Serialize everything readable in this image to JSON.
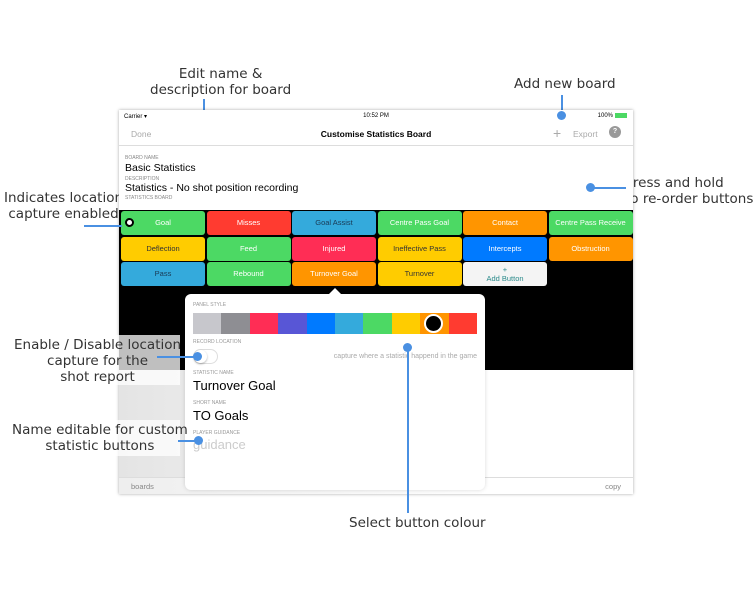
{
  "annotations": {
    "edit_name": "Edit name &\ndescription for board",
    "add_board": "Add new board",
    "location_capture": "Indicates location\ncapture enabled",
    "press_hold": "Press and hold\nto re-order buttons",
    "enable_disable": "Enable / Disable location\ncapture for the\nshot report",
    "name_editable": "Name editable for custom\nstatistic buttons",
    "select_colour": "Select button colour"
  },
  "status_bar": {
    "carrier": "Carrier",
    "time": "10:52 PM",
    "battery": "100%"
  },
  "nav": {
    "done": "Done",
    "title": "Customise Statistics Board",
    "add": "+",
    "export": "Export",
    "help": "?"
  },
  "board": {
    "name_label": "Board Name",
    "name": "Basic Statistics",
    "description_label": "Description",
    "description": "Statistics - No shot position recording",
    "section_label": "Statistics Board"
  },
  "buttons": [
    {
      "label": "Goal",
      "color": "#4cd964",
      "text": "#fff",
      "location": true
    },
    {
      "label": "Misses",
      "color": "#ff3b30",
      "text": "#fff"
    },
    {
      "label": "Goal Assist",
      "color": "#34aadc",
      "text": "#1a3a55"
    },
    {
      "label": "Centre Pass Goal",
      "color": "#4cd964",
      "text": "#fff"
    },
    {
      "label": "Contact",
      "color": "#ff9500",
      "text": "#fff"
    },
    {
      "label": "Centre Pass Receive",
      "color": "#4cd964",
      "text": "#fff"
    },
    {
      "label": "Deflection",
      "color": "#ffcc00",
      "text": "#333"
    },
    {
      "label": "Feed",
      "color": "#4cd964",
      "text": "#fff"
    },
    {
      "label": "Injured",
      "color": "#ff2d55",
      "text": "#fff"
    },
    {
      "label": "Ineffective Pass",
      "color": "#ffcc00",
      "text": "#333"
    },
    {
      "label": "Intercepts",
      "color": "#007aff",
      "text": "#fff"
    },
    {
      "label": "Obstruction",
      "color": "#ff9500",
      "text": "#fff"
    },
    {
      "label": "Pass",
      "color": "#34aadc",
      "text": "#1a3a55"
    },
    {
      "label": "Rebound",
      "color": "#4cd964",
      "text": "#fff"
    },
    {
      "label": "Turnover Goal",
      "color": "#ff9500",
      "text": "#fff"
    },
    {
      "label": "Turnover",
      "color": "#ffcc00",
      "text": "#333"
    },
    {
      "label": "+\nAdd Button",
      "color": "#f4f4f4",
      "text": "#2a8a8a"
    }
  ],
  "toolbar": {
    "left": "boards",
    "right": "copy"
  },
  "popover": {
    "panel_style_label": "Panel Style",
    "swatches": [
      "#c7c7cc",
      "#8e8e93",
      "#ff2d55",
      "#5856d6",
      "#007aff",
      "#34aadc",
      "#4cd964",
      "#ffcc00",
      "#ff9500",
      "#ff3b30"
    ],
    "selected_swatch": 8,
    "record_location_label": "Record Location",
    "record_location_hint": "capture where a statistic happend in the game",
    "record_location_on": false,
    "statistic_name_label": "Statistic Name",
    "statistic_name": "Turnover Goal",
    "short_name_label": "Short Name",
    "short_name": "TO Goals",
    "player_guidance_label": "Player Guidance",
    "player_guidance_placeholder": "guidance"
  }
}
